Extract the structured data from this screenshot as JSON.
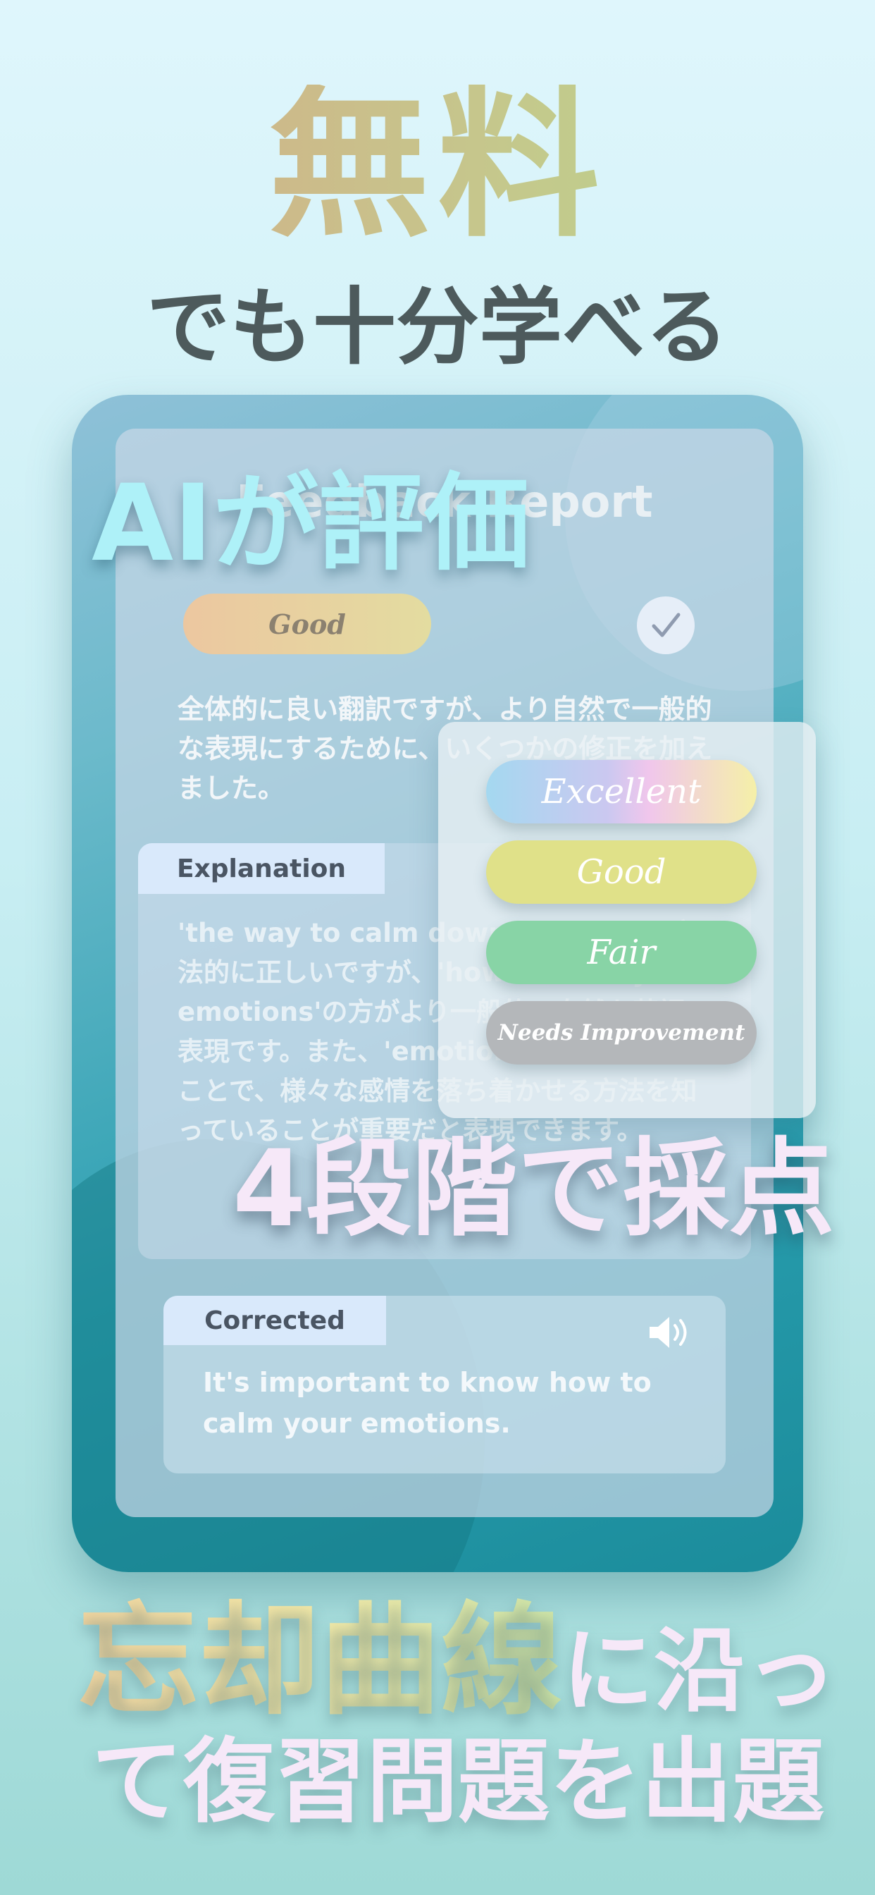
{
  "headline": {
    "free": "無料",
    "sub": "でも十分学べる"
  },
  "device": {
    "report_title": "Feedback Report",
    "overlay_ai_eval": "AIが評価",
    "rating_badge": "Good",
    "check_icon": "check-icon",
    "summary": "全体的に良い翻訳ですが、より自然で一般的な表現にするために、いくつかの修正を加えました。",
    "explanation": {
      "tab_label": "Explanation",
      "text": " 'the way to calm down emotion'は文法的に正しいですが、'how to calm your emotions'の方がより一般的で自然な英語の表現です。また、'emotion'を複数形にすることで、様々な感情を落ち着かせる方法を知っていることが重要だと表現できます。"
    },
    "rating_options": [
      "Excellent",
      "Good",
      "Fair",
      "Needs Improvement"
    ],
    "overlay_four_stage": "4段階で採点",
    "corrected": {
      "tab_label": "Corrected",
      "speaker_icon": "speaker-icon",
      "text": "It's important to know how to calm your emotions."
    }
  },
  "bottom": {
    "line1_highlight": "忘却曲線",
    "line1_rest": "に沿っ",
    "line2": "て復習問題を出題"
  },
  "colors": {
    "background_top": "#dff6fc",
    "background_bottom": "#9ed9d6",
    "overlay_cyan": "#aef1f8",
    "overlay_pink": "#f6e8f8",
    "headline_dark": "#4d5a5c"
  }
}
